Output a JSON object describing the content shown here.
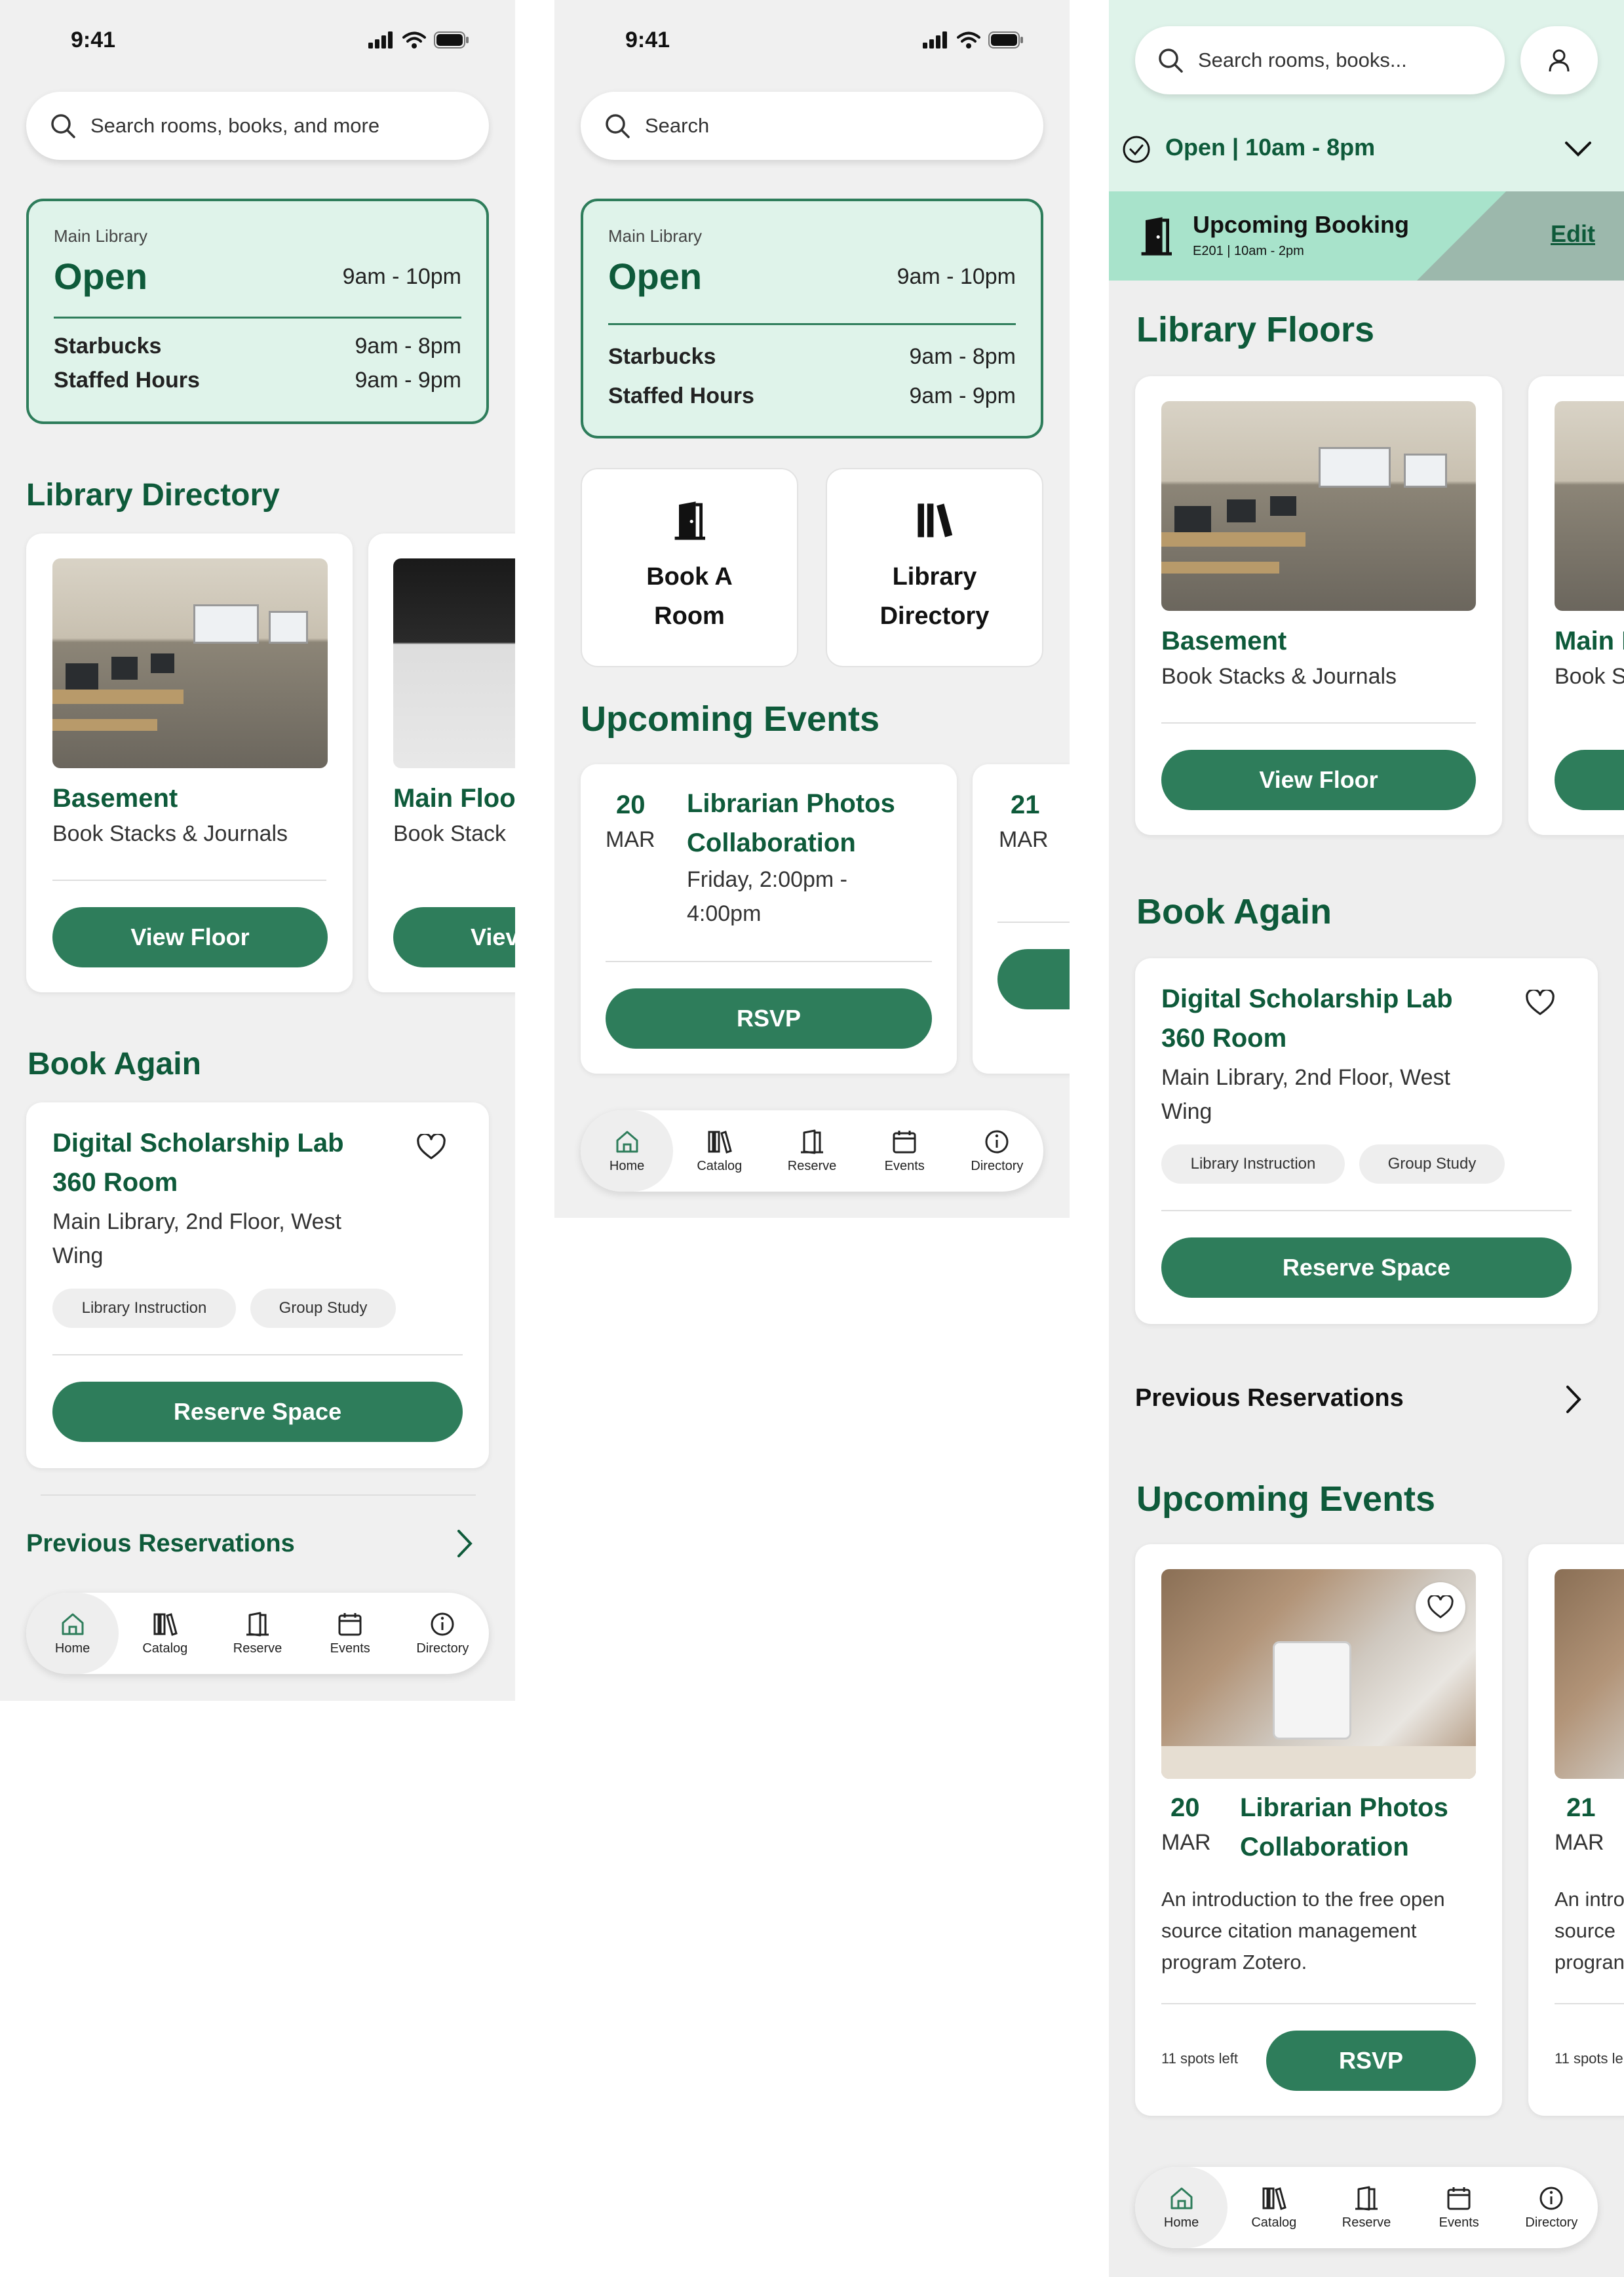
{
  "status": {
    "time": "9:41"
  },
  "screen1": {
    "search_placeholder": "Search rooms, books, and more",
    "hours": {
      "location": "Main Library",
      "status": "Open",
      "main_hours": "9am - 10pm",
      "rows": [
        {
          "label": "Starbucks",
          "value": "9am - 8pm"
        },
        {
          "label": "Staffed Hours",
          "value": "9am - 9pm"
        }
      ]
    },
    "directory_title": "Library Directory",
    "floors": [
      {
        "title": "Basement",
        "subtitle": "Book Stacks & Journals",
        "button": "View Floor"
      },
      {
        "title": "Main Floo",
        "subtitle": "Book Stack",
        "button": "Viev"
      }
    ],
    "book_again_title": "Book Again",
    "room": {
      "title_line1": "Digital Scholarship Lab",
      "title_line2": "360 Room",
      "location_line1": "Main Library, 2nd Floor, West",
      "location_line2": "Wing",
      "tags": [
        "Library Instruction",
        "Group Study"
      ],
      "button": "Reserve Space"
    },
    "previous_reservations": "Previous Reservations"
  },
  "screen2": {
    "search_placeholder": "Search",
    "hours": {
      "location": "Main Library",
      "status": "Open",
      "main_hours": "9am - 10pm",
      "rows": [
        {
          "label": "Starbucks",
          "value": "9am - 8pm"
        },
        {
          "label": "Staffed Hours",
          "value": "9am - 9pm"
        }
      ]
    },
    "actions": [
      {
        "line1": "Book A",
        "line2": "Room"
      },
      {
        "line1": "Library",
        "line2": "Directory"
      }
    ],
    "events_title": "Upcoming Events",
    "events": [
      {
        "day": "20",
        "month": "MAR",
        "title_line1": "Librarian Photos",
        "title_line2": "Collaboration",
        "time_line1": "Friday, 2:00pm -",
        "time_line2": "4:00pm",
        "button": "RSVP"
      },
      {
        "day": "21",
        "month": "MAR"
      }
    ]
  },
  "screen3": {
    "search_placeholder": "Search rooms, books...",
    "open_status": "Open | 10am - 8pm",
    "booking": {
      "title": "Upcoming Booking",
      "detail": "E201 | 10am - 2pm",
      "edit": "Edit"
    },
    "floors_title": "Library Floors",
    "floors": [
      {
        "title": "Basement",
        "subtitle": "Book Stacks & Journals",
        "button": "View Floor"
      },
      {
        "title": "Main I",
        "subtitle": "Book S"
      }
    ],
    "book_again_title": "Book Again",
    "room": {
      "title_line1": "Digital Scholarship Lab",
      "title_line2": "360 Room",
      "location_line1": "Main Library, 2nd Floor, West",
      "location_line2": "Wing",
      "tags": [
        "Library Instruction",
        "Group Study"
      ],
      "button": "Reserve Space"
    },
    "previous_reservations": "Previous Reservations",
    "events_title": "Upcoming Events",
    "events": [
      {
        "day": "20",
        "month": "MAR",
        "title_line1": "Librarian Photos",
        "title_line2": "Collaboration",
        "desc_line1": "An introduction to the free open",
        "desc_line2": "source citation management",
        "desc_line3": "program Zotero.",
        "spots": "11 spots left",
        "button": "RSVP"
      },
      {
        "day": "21",
        "month": "MAR",
        "desc_line1": "An intro",
        "desc_line2": "source",
        "desc_line3": "progran",
        "spots": "11 spots le"
      }
    ]
  },
  "nav": {
    "items": [
      "Home",
      "Catalog",
      "Reserve",
      "Events",
      "Directory"
    ]
  },
  "colors": {
    "primary": "#2e7d5b",
    "dark_green": "#0e5a3a",
    "mint": "#dff3ea"
  }
}
